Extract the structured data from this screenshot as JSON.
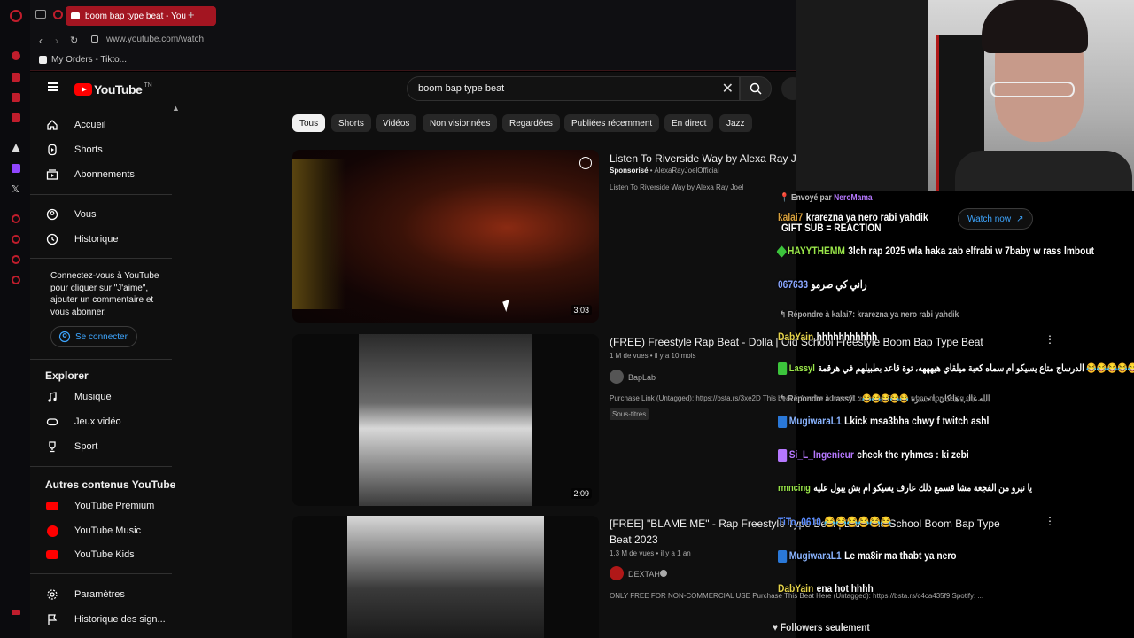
{
  "browser": {
    "tab_title": "boom bap type beat - You",
    "url": "www.youtube.com/watch",
    "bookmark": "My Orders - Tikto..."
  },
  "youtube": {
    "logo_text": "YouTube",
    "logo_region": "TN",
    "search_value": "boom bap type beat",
    "sidebar": {
      "main": [
        {
          "label": "Accueil",
          "icon": "home-icon"
        },
        {
          "label": "Shorts",
          "icon": "shorts-icon"
        },
        {
          "label": "Abonnements",
          "icon": "subscriptions-icon"
        }
      ],
      "you": [
        {
          "label": "Vous",
          "icon": "user-icon"
        },
        {
          "label": "Historique",
          "icon": "history-icon"
        }
      ],
      "signin_text": "Connectez-vous à YouTube pour cliquer sur \"J'aime\", ajouter un commentaire et vous abonner.",
      "signin_button": "Se connecter",
      "explore_heading": "Explorer",
      "explore": [
        {
          "label": "Musique",
          "icon": "music-icon"
        },
        {
          "label": "Jeux vidéo",
          "icon": "gaming-icon"
        },
        {
          "label": "Sport",
          "icon": "trophy-icon"
        }
      ],
      "more_heading": "Autres contenus YouTube",
      "more": [
        {
          "label": "YouTube Premium"
        },
        {
          "label": "YouTube Music"
        },
        {
          "label": "YouTube Kids"
        }
      ],
      "settings": [
        {
          "label": "Paramètres",
          "icon": "gear-icon"
        },
        {
          "label": "Historique des sign...",
          "icon": "flag-icon"
        }
      ]
    },
    "chips": [
      "Tous",
      "Shorts",
      "Vidéos",
      "Non visionnées",
      "Regardées",
      "Publiées récemment",
      "En direct",
      "Jazz"
    ],
    "videos": [
      {
        "title": "Listen To Riverside Way by Alexa Ray J",
        "sponsored": "Sponsorisé",
        "channel": "AlexaRayJoelOfficial",
        "description": "Listen To Riverside Way by Alexa Ray Joel",
        "duration": "3:03",
        "watch_now": "Watch now"
      },
      {
        "title": "(FREE) Freestyle Rap Beat - Dolla | Old School Freestyle Boom Bap Type Beat",
        "meta": "1 M de vues • il y a 10 mois",
        "channel": "BapLab",
        "description": "Purchase Link (Untagged): https://bsta.rs/3xe2D This beat is free for non-profit use only. Please when monetising on...",
        "badge": "Sous-titres",
        "duration": "2:09"
      },
      {
        "title": "[FREE] \"BLAME ME\" - Rap Freestyle Type Beat | Dark Old School Boom Bap Type",
        "title2": "Beat 2023",
        "meta": "1,3 M de vues • il y a 1 an",
        "channel": "DEXTAH",
        "description": "ONLY FREE FOR NON-COMMERCIAL USE Purchase This Beat Here (Untagged): https://bsta.rs/c4ca435f9 Spotify: ..."
      }
    ]
  },
  "chat": {
    "sent_by": "Envoyé par",
    "sent_by_name": "NeroMama",
    "gift_label": "GIFT SUB = REACTION",
    "followers_only": "Followers seulement",
    "messages": [
      {
        "user": "kalai7",
        "text": "krarezna ya nero rabi yahdik",
        "color": "#d7a03c"
      },
      {
        "user": "HAYYTHEMM",
        "text": "3lch rap 2025 wla haka zab elfrabi w 7baby w rass lmbout",
        "color": "#9be84a"
      },
      {
        "user": "067633",
        "text": "راني كي صرمو",
        "color": "#8aa6ff"
      },
      {
        "reply_to": "Répondre à kalai7: krarezna ya nero rabi yahdik"
      },
      {
        "user": "DabYain",
        "text": "hhhhhhhhhhh",
        "color": "#e6d44a"
      },
      {
        "user": "Lassyl",
        "text": "الدرساج متاع يسيكو ام سماه كعبة ميلقاي هيهههه، توة قاعد بطبيلهم في هرقمة 😂😂😂😂😂",
        "color": "#9be84a"
      },
      {
        "reply_to": "Répondre à LassyL: 😂😂😂😂😂 الله غالب ها كان يا حسرة"
      },
      {
        "user": "MugiwaraL1",
        "text": "Lkick msa3bha chwy f twitch ashl",
        "color": "#8ab4ff"
      },
      {
        "user": "Si_L_Ingenieur",
        "text": "check the ryhmes : ki zebi",
        "color": "#b678ff"
      },
      {
        "user": "rmncing",
        "text": "يا نيرو من الفجعة مشا قسمع ذلك عارف يسيكو ام بش يبول عليه",
        "color": "#9be84a"
      },
      {
        "user": "TiTo_0610",
        "text": "😂😂😂😂😂😂",
        "color": "#5a8cff"
      },
      {
        "user": "MugiwaraL1",
        "text": "Le ma8ir ma thabt ya nero",
        "color": "#8ab4ff"
      },
      {
        "user": "DabYain",
        "text": "ena hot hhhh",
        "color": "#e6d44a"
      }
    ]
  }
}
